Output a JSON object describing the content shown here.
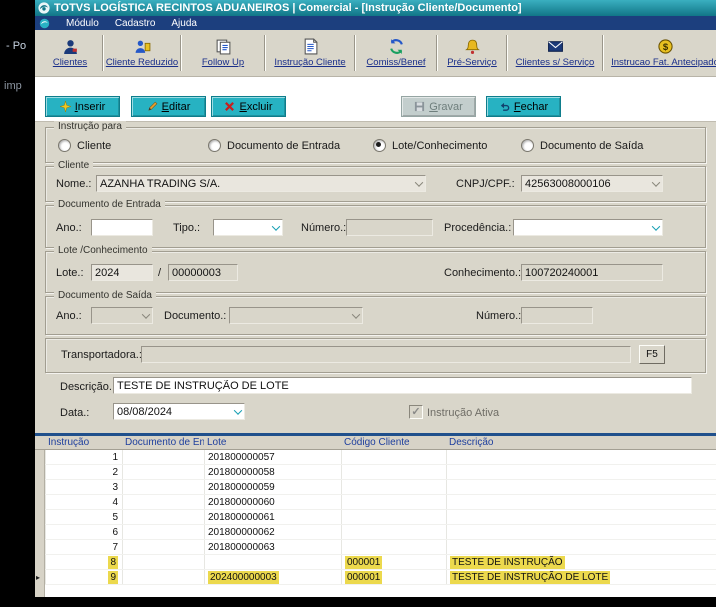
{
  "window_title": "TOTVS LOGÍSTICA RECINTOS ADUANEIROS | Comercial - [Instrução Cliente/Documento]",
  "fragments": {
    "top": "- Po",
    "mid": "imp"
  },
  "menu": {
    "items": [
      "Módulo",
      "Cadastro",
      "Ajuda"
    ]
  },
  "toolbar": {
    "items": [
      {
        "label": "Clientes",
        "icon": "person-icon"
      },
      {
        "label": "Cliente Reduzido",
        "icon": "person-small-icon"
      },
      {
        "label": "Follow Up",
        "icon": "followup-icon"
      },
      {
        "label": "Instrução Cliente",
        "icon": "document-icon"
      },
      {
        "label": "Comiss/Benef",
        "icon": "refresh-icon"
      },
      {
        "label": "Pré-Serviço",
        "icon": "bell-icon"
      },
      {
        "label": "Clientes s/ Serviço",
        "icon": "envelope-icon"
      },
      {
        "label": "Instrucao Fat. Antecipado",
        "icon": "money-icon"
      }
    ]
  },
  "actions": {
    "inserir": "Inserir",
    "editar": "Editar",
    "excluir": "Excluir",
    "gravar": "Gravar",
    "fechar": "Fechar"
  },
  "instrucao_para": {
    "caption": "Instrução para",
    "options": [
      "Cliente",
      "Documento de Entrada",
      "Lote/Conhecimento",
      "Documento de Saída"
    ],
    "selected_index": 2
  },
  "cliente": {
    "caption": "Cliente",
    "nome_label": "Nome.:",
    "nome_value": "AZANHA TRADING S/A.",
    "cnpj_label": "CNPJ/CPF.:",
    "cnpj_value": "42563008000106"
  },
  "documento_entrada": {
    "caption": "Documento de Entrada",
    "ano_label": "Ano.:",
    "ano_value": "",
    "tipo_label": "Tipo.:",
    "tipo_value": "",
    "numero_label": "Número.:",
    "numero_value": "",
    "procedencia_label": "Procedência.:",
    "procedencia_value": ""
  },
  "lote_conhecimento": {
    "caption": "Lote /Conhecimento",
    "lote_label": "Lote.:",
    "lote_ano": "2024",
    "separator": "/",
    "lote_numero": "00000003",
    "conhecimento_label": "Conhecimento.:",
    "conhecimento_value": "100720240001"
  },
  "documento_saida": {
    "caption": "Documento de Saída",
    "ano_label": "Ano.:",
    "ano_value": "",
    "documento_label": "Documento.:",
    "documento_value": "",
    "numero_label": "Número.:",
    "numero_value": ""
  },
  "transportadora": {
    "label": "Transportadora.:",
    "value": "",
    "f5_label": "F5"
  },
  "descricao": {
    "label": "Descrição.:",
    "value": "TESTE DE INSTRUÇÃO DE LOTE"
  },
  "data_field": {
    "label": "Data.:",
    "value": "08/08/2024"
  },
  "instrucao_ativa": {
    "label": "Instrução Ativa",
    "checked": true
  },
  "grid": {
    "columns": [
      "Instrução",
      "Documento de Entrada",
      "Lote",
      "Código Cliente",
      "Descrição"
    ],
    "rows": [
      {
        "instrucao": "1",
        "doc_entrada": "",
        "lote": "201800000057",
        "codigo": "",
        "descricao": "",
        "highlight": false,
        "current": false
      },
      {
        "instrucao": "2",
        "doc_entrada": "",
        "lote": "201800000058",
        "codigo": "",
        "descricao": "",
        "highlight": false,
        "current": false
      },
      {
        "instrucao": "3",
        "doc_entrada": "",
        "lote": "201800000059",
        "codigo": "",
        "descricao": "",
        "highlight": false,
        "current": false
      },
      {
        "instrucao": "4",
        "doc_entrada": "",
        "lote": "201800000060",
        "codigo": "",
        "descricao": "",
        "highlight": false,
        "current": false
      },
      {
        "instrucao": "5",
        "doc_entrada": "",
        "lote": "201800000061",
        "codigo": "",
        "descricao": "",
        "highlight": false,
        "current": false
      },
      {
        "instrucao": "6",
        "doc_entrada": "",
        "lote": "201800000062",
        "codigo": "",
        "descricao": "",
        "highlight": false,
        "current": false
      },
      {
        "instrucao": "7",
        "doc_entrada": "",
        "lote": "201800000063",
        "codigo": "",
        "descricao": "",
        "highlight": false,
        "current": false
      },
      {
        "instrucao": "8",
        "doc_entrada": "",
        "lote": "",
        "codigo": "000001",
        "descricao": "TESTE DE INSTRUÇÃO",
        "highlight": true,
        "current": false
      },
      {
        "instrucao": "9",
        "doc_entrada": "",
        "lote": "202400000003",
        "codigo": "000001",
        "descricao": "TESTE DE INSTRUÇÃO DE LOTE",
        "highlight": true,
        "current": true
      }
    ]
  },
  "colors": {
    "titlebar_teal": "#1d93a5",
    "menubar_navy": "#1c3f7e",
    "button_cyan": "#27b2c2",
    "highlight_yellow": "#ecd94d",
    "grid_header_blue": "#1e3f9e"
  }
}
